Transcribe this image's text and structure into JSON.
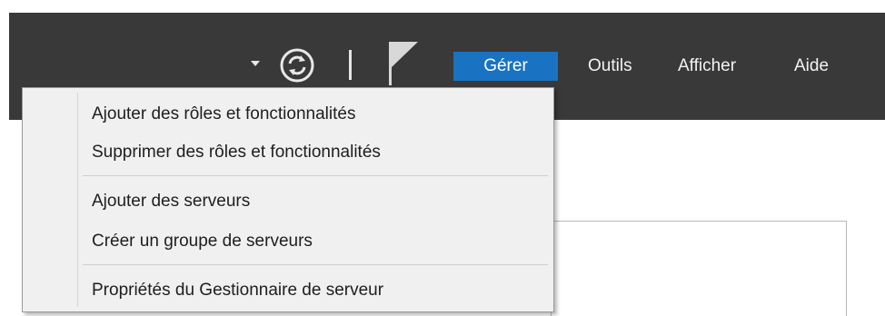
{
  "menubar": {
    "items": [
      {
        "label": "Gérer",
        "active": true
      },
      {
        "label": "Outils",
        "active": false
      },
      {
        "label": "Afficher",
        "active": false
      },
      {
        "label": "Aide",
        "active": false
      }
    ]
  },
  "toolbar": {
    "icons": [
      "chevron-down-icon",
      "refresh-icon",
      "flag-icon"
    ]
  },
  "dropdown": {
    "groups": [
      [
        "Ajouter des rôles et fonctionnalités",
        "Supprimer des rôles et fonctionnalités"
      ],
      [
        "Ajouter des serveurs",
        "Créer un groupe de serveurs"
      ],
      [
        "Propriétés du Gestionnaire de serveur"
      ]
    ]
  },
  "colors": {
    "header_bg": "#393939",
    "accent": "#1a73c2",
    "menu_bg": "#f0f0f0"
  }
}
